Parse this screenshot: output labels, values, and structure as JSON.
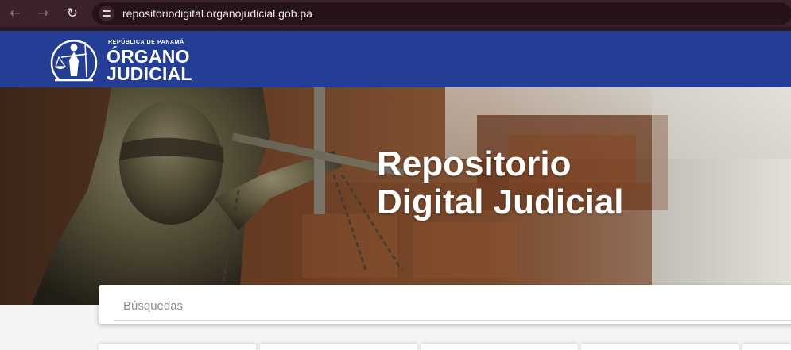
{
  "browser": {
    "url": "repositoriodigital.organojudicial.gob.pa",
    "back_icon": "←",
    "forward_icon": "→",
    "reload_icon": "↻"
  },
  "header": {
    "logo_small": "REPÚBLICA DE PANAMÁ",
    "logo_line1": "ÓRGANO",
    "logo_line2": "JUDICIAL",
    "color": "#243d95"
  },
  "hero": {
    "title_line1": "Repositorio",
    "title_line2": "Digital Judicial"
  },
  "search": {
    "placeholder": "Búsquedas"
  }
}
